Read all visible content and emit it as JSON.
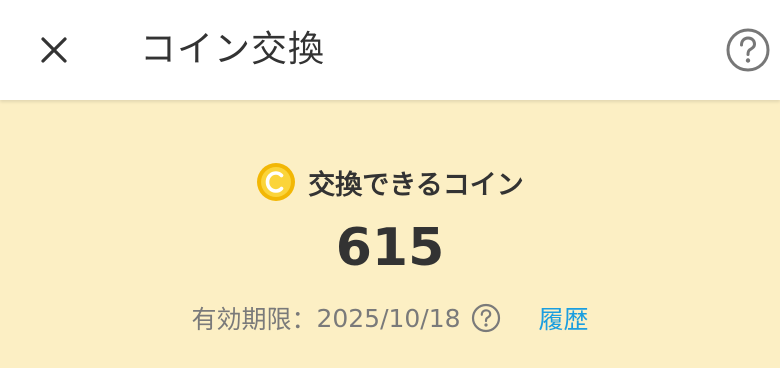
{
  "header": {
    "title": "コイン交換",
    "close_icon": "close-icon",
    "help_icon": "question-circle-icon"
  },
  "balance": {
    "label": "交換できるコイン",
    "coin_icon": "coin-icon",
    "amount": "615",
    "expiry_label": "有効期限：",
    "expiry_date": "2025/10/18",
    "history_link": "履歴"
  },
  "colors": {
    "background": "#fcefc4",
    "header_bg": "#ffffff",
    "coin": "#f7c51e",
    "link": "#1a9ee0",
    "text": "#333333",
    "muted": "#7a7a7a"
  }
}
